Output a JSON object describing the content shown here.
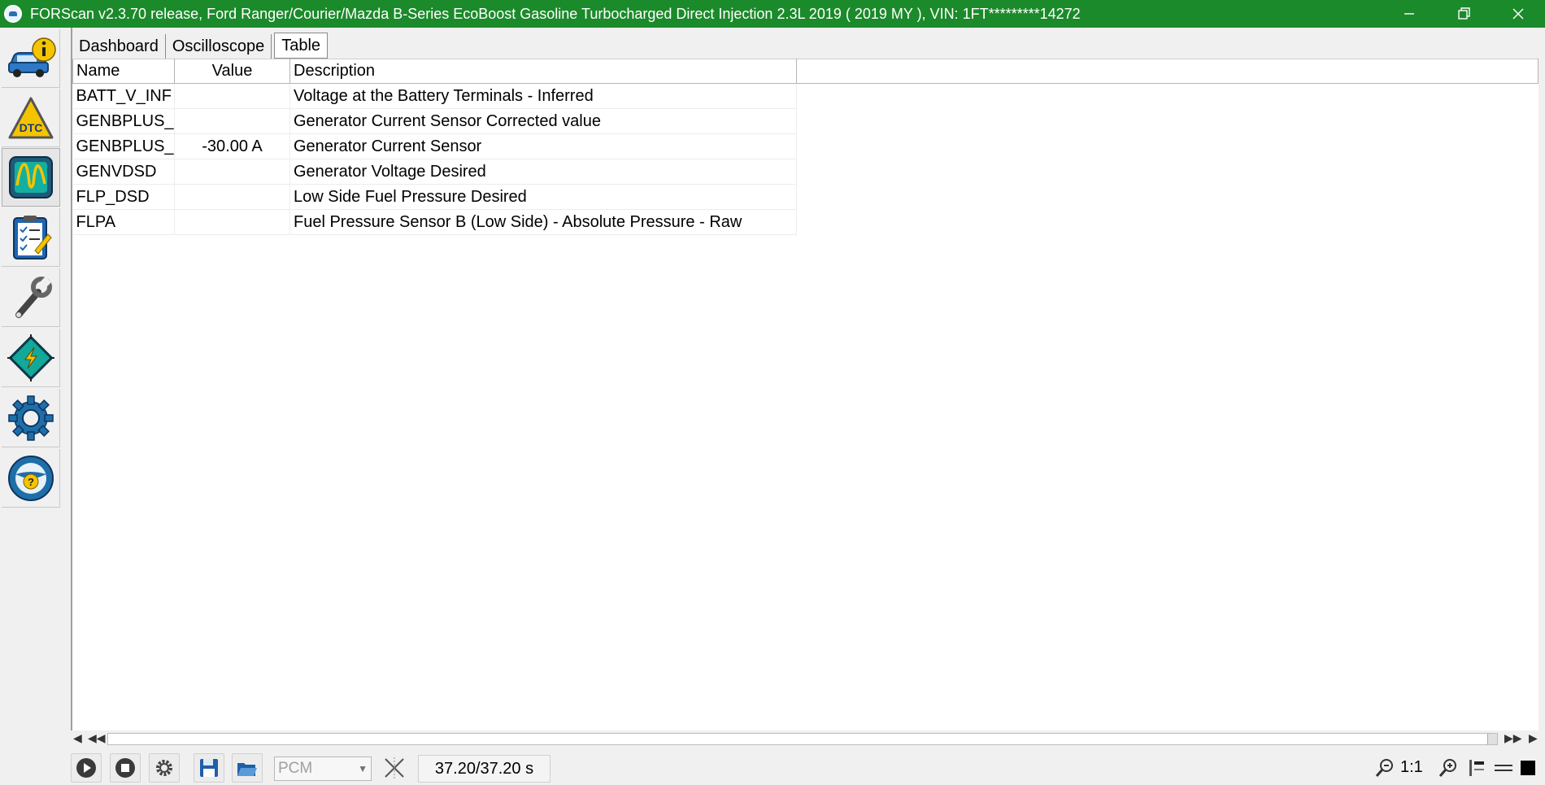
{
  "window": {
    "title": "FORScan v2.3.70 release, Ford Ranger/Courier/Mazda B-Series EcoBoost Gasoline Turbocharged Direct Injection 2.3L 2019 ( 2019 MY ), VIN: 1FT*********14272",
    "accent": "#1b8a2a"
  },
  "sidebar": {
    "items": [
      {
        "icon": "vehicle-info-icon"
      },
      {
        "icon": "dtc-icon",
        "label": "DTC"
      },
      {
        "icon": "oscilloscope-icon"
      },
      {
        "icon": "checklist-icon"
      },
      {
        "icon": "wrench-icon"
      },
      {
        "icon": "module-chip-icon"
      },
      {
        "icon": "gear-icon"
      },
      {
        "icon": "help-wheel-icon",
        "label": "?"
      }
    ]
  },
  "tabs": [
    {
      "label": "Dashboard"
    },
    {
      "label": "Oscilloscope"
    },
    {
      "label": "Table",
      "active": true
    }
  ],
  "table": {
    "headers": {
      "name": "Name",
      "value": "Value",
      "description": "Description"
    },
    "rows": [
      {
        "name": "BATT_V_INF",
        "value": "",
        "description": "Voltage at the Battery Terminals - Inferred"
      },
      {
        "name": "GENBPLUS_CC",
        "value": "",
        "description": "Generator Current Sensor Corrected value"
      },
      {
        "name": "GENBPLUS_SN",
        "value": "-30.00 A",
        "description": "Generator Current Sensor"
      },
      {
        "name": "GENVDSD",
        "value": "",
        "description": "Generator Voltage Desired"
      },
      {
        "name": "FLP_DSD",
        "value": "",
        "description": "Low Side Fuel Pressure Desired"
      },
      {
        "name": "FLPA",
        "value": "",
        "description": "Fuel Pressure Sensor B (Low Side) - Absolute Pressure - Raw"
      }
    ]
  },
  "toolbar": {
    "module_select": "PCM",
    "time_display": "37.20/37.20 s",
    "zoom_ratio": "1:1"
  }
}
